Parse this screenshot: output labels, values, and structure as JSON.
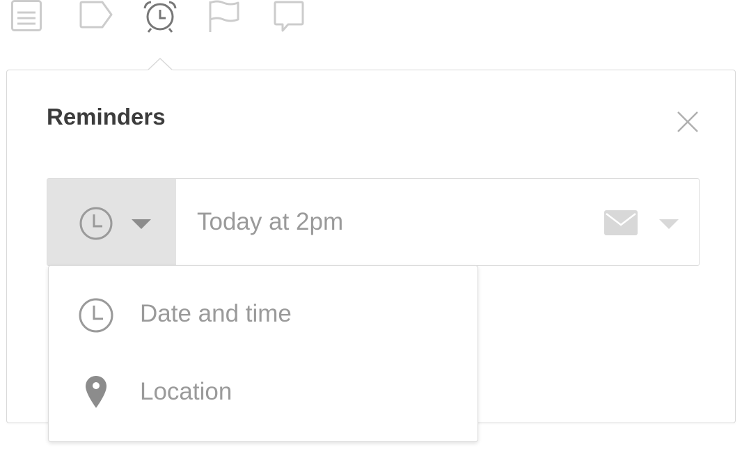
{
  "toolbar": {
    "icons": [
      {
        "name": "notes-icon",
        "active": false
      },
      {
        "name": "tag-icon",
        "active": false
      },
      {
        "name": "alarm-clock-icon",
        "active": true
      },
      {
        "name": "flag-icon",
        "active": false
      },
      {
        "name": "comment-icon",
        "active": false
      }
    ]
  },
  "panel": {
    "title": "Reminders",
    "close_icon": "close-icon"
  },
  "reminder": {
    "type_icon": "clock-icon",
    "type_caret_icon": "chevron-down-icon",
    "input_placeholder": "Today at 2pm",
    "input_value": "",
    "notify_icon": "envelope-icon",
    "notify_caret_icon": "chevron-down-icon"
  },
  "dropdown": {
    "items": [
      {
        "label": "Date and time",
        "icon": "clock-icon"
      },
      {
        "label": "Location",
        "icon": "map-pin-icon"
      }
    ]
  },
  "colors": {
    "icon_muted": "#cccccc",
    "icon_active": "#777777",
    "text_title": "#3c3c3c",
    "text_muted": "#9a9a9a",
    "selector_bg": "#e3e3e3",
    "border": "#dcdcdc"
  }
}
